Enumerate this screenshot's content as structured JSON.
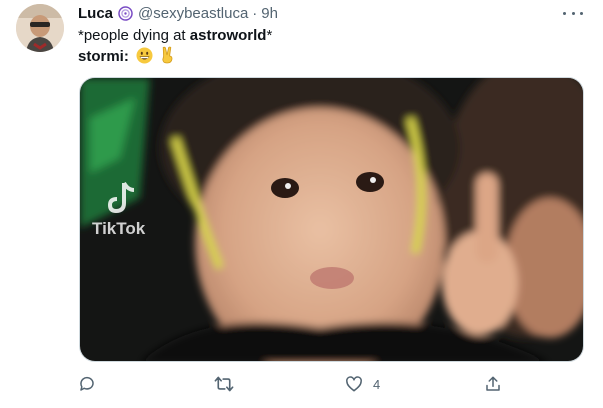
{
  "tweet": {
    "author_name": "Luca",
    "handle": "@sexybeastluca",
    "separator": "·",
    "time": "9h",
    "line1_before": "*people dying at ",
    "line1_bold": "astroworld",
    "line1_after": "*",
    "line2_label": "stormi:",
    "emoji_1": "grinning-face-emoji",
    "emoji_2": "victory-hand-emoji",
    "media_watermark": "TikTok",
    "like_count": "4",
    "colors": {
      "text": "#0f1419",
      "secondary": "#536471",
      "border": "#cfd9de",
      "badge": "#794bc4"
    },
    "icons": {
      "reply": "speech-bubble-icon",
      "retweet": "retweet-icon",
      "like": "heart-icon",
      "share": "share-icon",
      "more": "more-options-icon",
      "badge": "spiral-badge-icon"
    }
  }
}
